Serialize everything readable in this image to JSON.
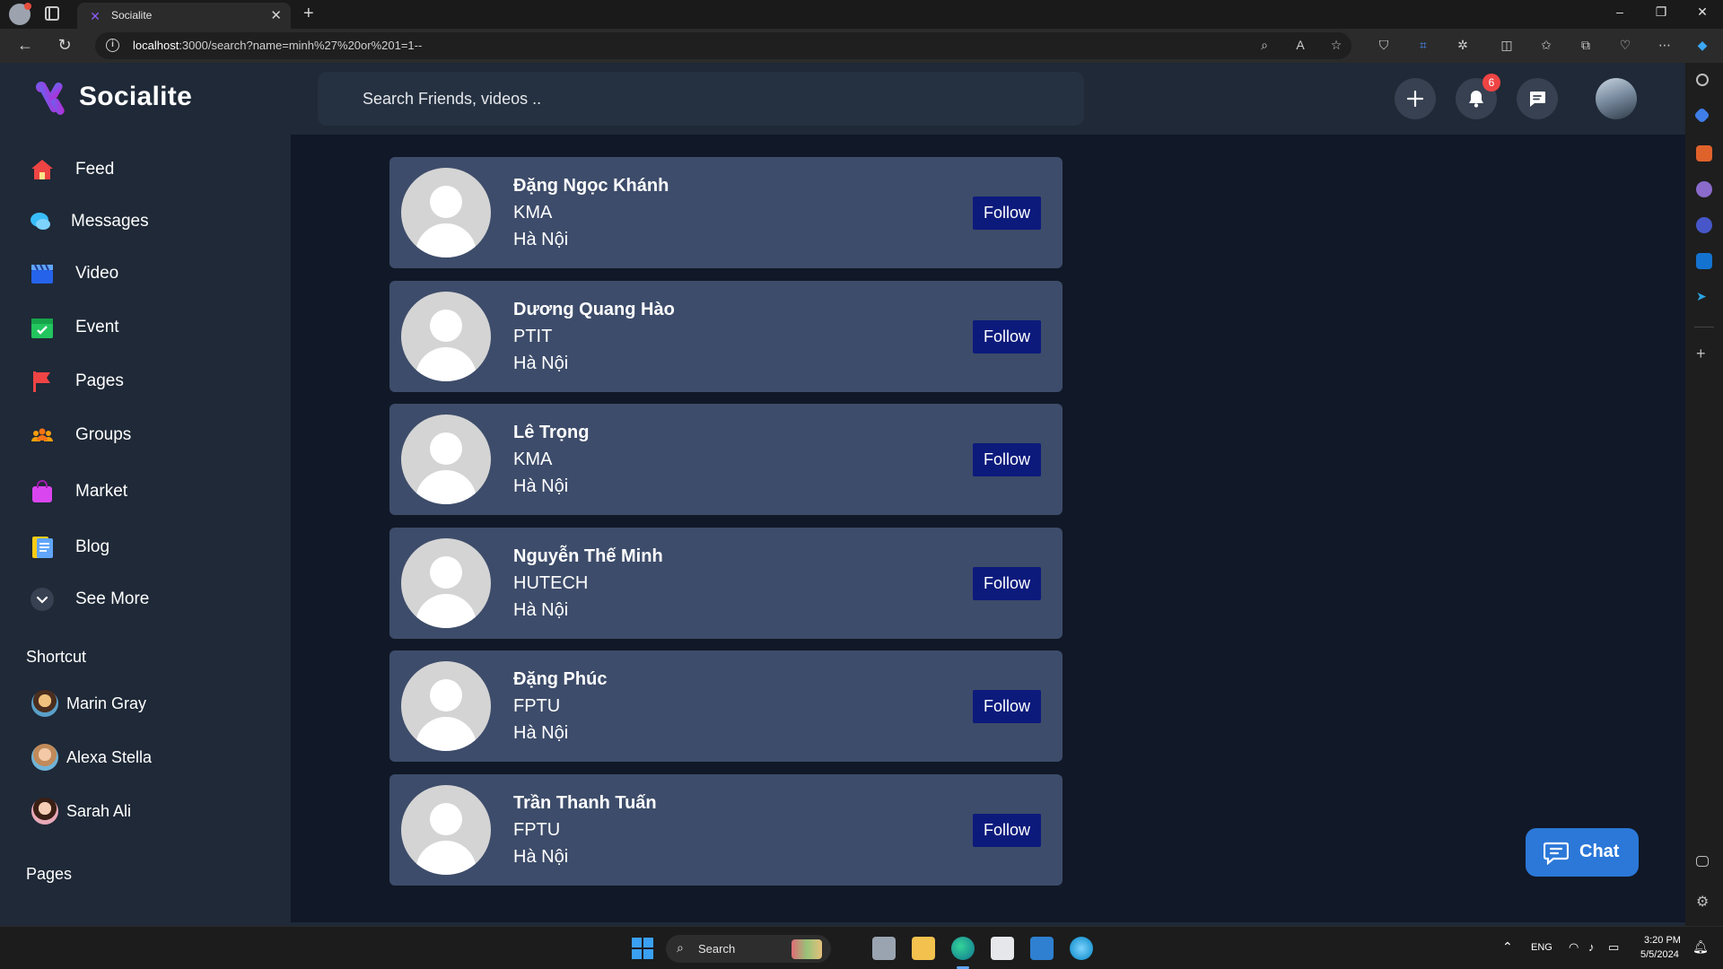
{
  "browser": {
    "tab_title": "Socialite",
    "url_host": "localhost",
    "url_rest": ":3000/search?name=minh%27%20or%201=1--"
  },
  "app": {
    "brand": "Socialite",
    "search_placeholder": "Search Friends, videos ..",
    "notification_count": "6"
  },
  "sidebar": {
    "nav": [
      {
        "label": "Feed"
      },
      {
        "label": "Messages"
      },
      {
        "label": "Video"
      },
      {
        "label": "Event"
      },
      {
        "label": "Pages"
      },
      {
        "label": "Groups"
      },
      {
        "label": "Market"
      },
      {
        "label": "Blog"
      },
      {
        "label": "See More"
      }
    ],
    "shortcut_title": "Shortcut",
    "shortcuts": [
      {
        "name": "Marin Gray"
      },
      {
        "name": "Alexa Stella"
      },
      {
        "name": "Sarah Ali"
      }
    ],
    "pages_title": "Pages"
  },
  "results": [
    {
      "name": "Đặng Ngọc Khánh",
      "school": "KMA",
      "city": "Hà Nội",
      "action": "Follow"
    },
    {
      "name": "Dương Quang Hào",
      "school": "PTIT",
      "city": "Hà Nội",
      "action": "Follow"
    },
    {
      "name": "Lê Trọng",
      "school": "KMA",
      "city": "Hà Nội",
      "action": "Follow"
    },
    {
      "name": "Nguyễn Thế Minh",
      "school": "HUTECH",
      "city": "Hà Nội",
      "action": "Follow"
    },
    {
      "name": "Đặng Phúc",
      "school": "FPTU",
      "city": "Hà Nội",
      "action": "Follow"
    },
    {
      "name": "Trần Thanh Tuấn",
      "school": "FPTU",
      "city": "Hà Nội",
      "action": "Follow"
    }
  ],
  "chat_label": "Chat",
  "taskbar": {
    "search_label": "Search",
    "lang": "ENG",
    "time": "3:20 PM",
    "date": "5/5/2024"
  }
}
